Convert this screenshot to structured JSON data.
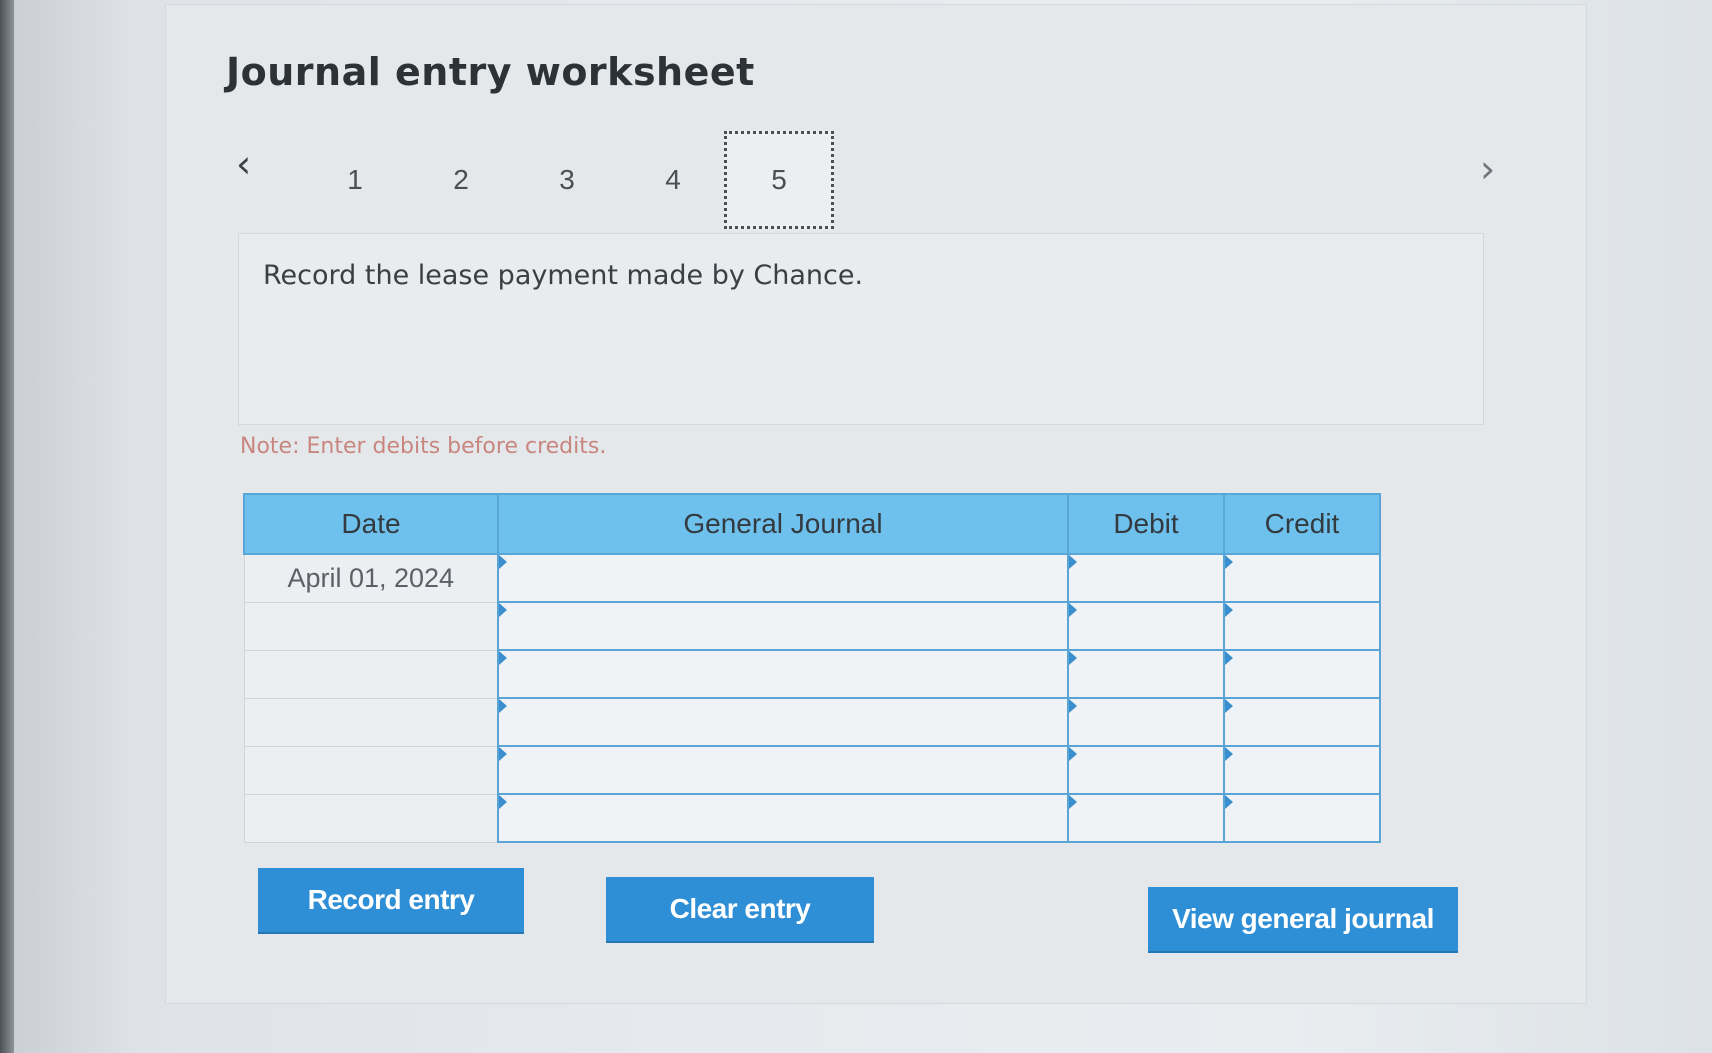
{
  "worksheet": {
    "title": "Journal entry worksheet",
    "prev_arrow": "‹",
    "next_arrow": "›",
    "steps": [
      "1",
      "2",
      "3",
      "4",
      "5"
    ],
    "active_step": "5"
  },
  "question": {
    "text": "Record the lease payment made by Chance."
  },
  "note": "Note: Enter debits before credits.",
  "journal_table": {
    "headers": {
      "date": "Date",
      "general_journal": "General Journal",
      "debit": "Debit",
      "credit": "Credit"
    },
    "rows": [
      {
        "date": "April 01, 2024",
        "account": "",
        "debit": "",
        "credit": ""
      },
      {
        "date": "",
        "account": "",
        "debit": "",
        "credit": ""
      },
      {
        "date": "",
        "account": "",
        "debit": "",
        "credit": ""
      },
      {
        "date": "",
        "account": "",
        "debit": "",
        "credit": ""
      },
      {
        "date": "",
        "account": "",
        "debit": "",
        "credit": ""
      },
      {
        "date": "",
        "account": "",
        "debit": "",
        "credit": ""
      }
    ]
  },
  "buttons": {
    "record": "Record entry",
    "clear": "Clear entry",
    "view": "View general journal"
  },
  "colors": {
    "header_blue": "#6fc1ed",
    "button_blue": "#2e8fd6",
    "note_text": "#c9867f"
  }
}
